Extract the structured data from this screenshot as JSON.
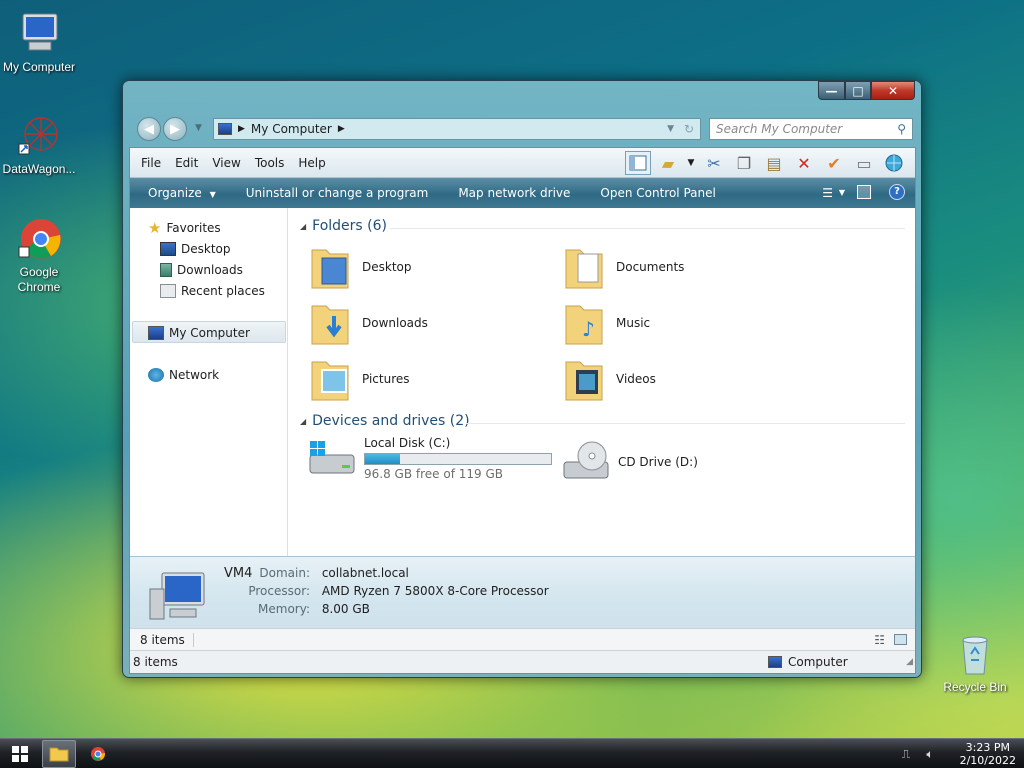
{
  "desktop": {
    "icons": [
      {
        "label": "My Computer"
      },
      {
        "label": "DataWagon..."
      },
      {
        "label": "Google Chrome"
      },
      {
        "label": "Recycle Bin"
      }
    ]
  },
  "window": {
    "address": {
      "path": "My Computer"
    },
    "search": {
      "placeholder": "Search My Computer"
    },
    "menu": {
      "file": "File",
      "edit": "Edit",
      "view": "View",
      "tools": "Tools",
      "help": "Help"
    },
    "commands": {
      "organize": "Organize",
      "uninstall": "Uninstall or change a program",
      "map_drive": "Map network drive",
      "control_panel": "Open Control Panel"
    },
    "nav": {
      "favorites": "Favorites",
      "desktop": "Desktop",
      "downloads": "Downloads",
      "recent": "Recent places",
      "my_computer": "My Computer",
      "network": "Network"
    },
    "folders_header": "Folders (6)",
    "folders": [
      "Desktop",
      "Documents",
      "Downloads",
      "Music",
      "Pictures",
      "Videos"
    ],
    "drives_header": "Devices and drives (2)",
    "drives": {
      "local": {
        "name": "Local Disk (C:)",
        "free": "96.8 GB free of 119 GB",
        "used_fraction": 0.19
      },
      "cd": {
        "name": "CD Drive (D:)"
      }
    },
    "details": {
      "name": "VM4",
      "domain_label": "Domain:",
      "domain": "collabnet.local",
      "processor_label": "Processor:",
      "processor": "AMD Ryzen 7 5800X 8-Core Processor",
      "memory_label": "Memory:",
      "memory": "8.00 GB"
    },
    "status_items": "8 items",
    "status_bottom_items": "8 items",
    "status_location": "Computer"
  },
  "taskbar": {
    "time": "3:23 PM",
    "date": "2/10/2022"
  }
}
